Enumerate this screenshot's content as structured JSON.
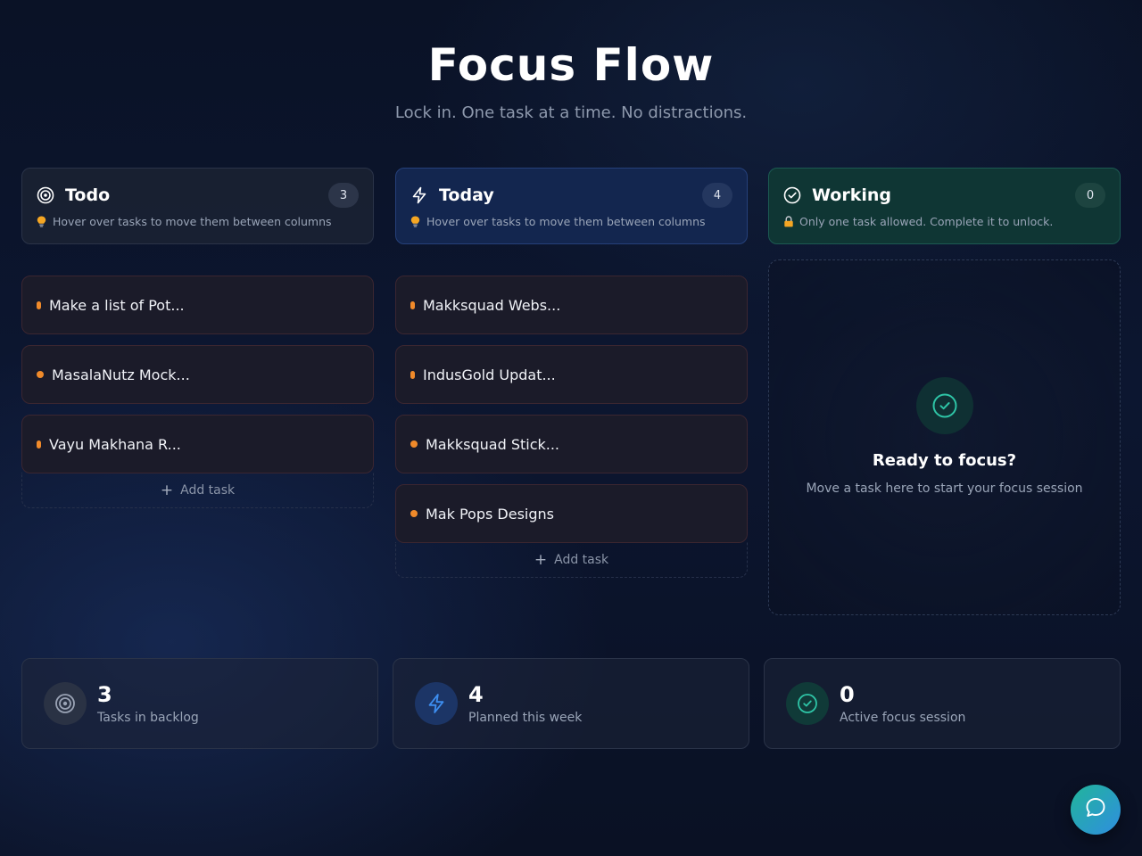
{
  "header": {
    "title": "Focus Flow",
    "subtitle": "Lock in. One task at a time. No distractions."
  },
  "columns": [
    {
      "title": "Todo",
      "count": "3",
      "hint": "Hover over tasks to move them between columns",
      "icon": "target-icon",
      "tasks": [
        "Make a list of Pot...",
        "MasalaNutz Mock...",
        "Vayu Makhana R..."
      ],
      "add_label": "Add task"
    },
    {
      "title": "Today",
      "count": "4",
      "hint": "Hover over tasks to move them between columns",
      "icon": "lightning-icon",
      "tasks": [
        "Makksquad Webs...",
        "IndusGold Updat...",
        "Makksquad Stick...",
        "Mak Pops Designs"
      ],
      "add_label": "Add task"
    },
    {
      "title": "Working",
      "count": "0",
      "hint": "Only one task allowed. Complete it to unlock.",
      "icon": "check-circle-icon"
    }
  ],
  "dropzone": {
    "title": "Ready to focus?",
    "subtitle": "Move a task here to start your focus session"
  },
  "stats": [
    {
      "value": "3",
      "label": "Tasks in backlog",
      "icon": "target-icon"
    },
    {
      "value": "4",
      "label": "Planned this week",
      "icon": "lightning-icon"
    },
    {
      "value": "0",
      "label": "Active focus session",
      "icon": "check-circle-icon"
    }
  ],
  "colors": {
    "today_accent": "#13264f",
    "working_accent": "#0f3634",
    "task_dot": "#f08a2a",
    "teal": "#2ec4a6"
  }
}
